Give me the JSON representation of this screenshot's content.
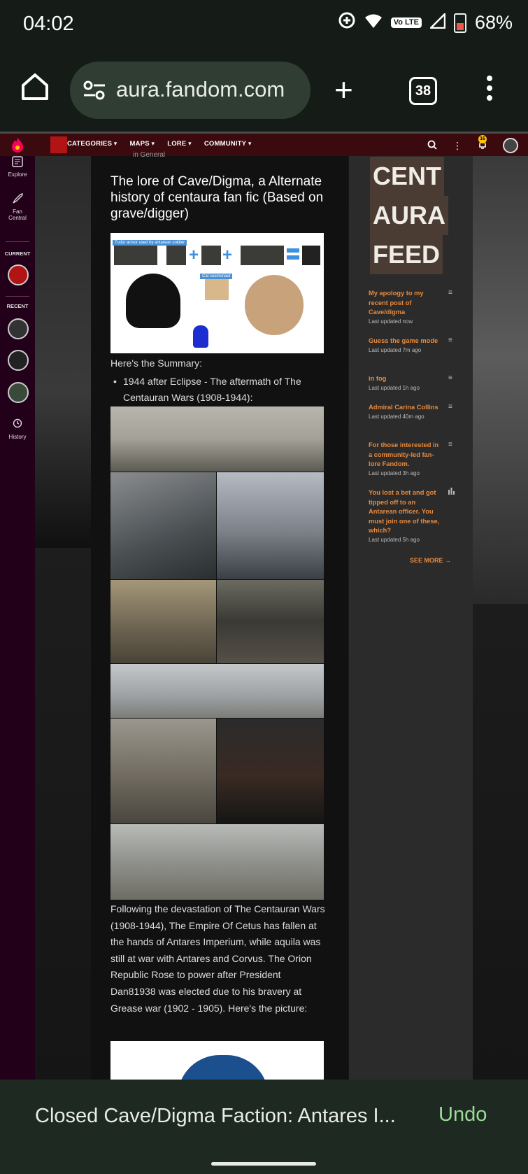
{
  "status": {
    "time": "04:02",
    "battery": "68%",
    "network_badge": "Vo LTE"
  },
  "browser": {
    "url": "aura.fandom.com",
    "tab_count": "38"
  },
  "site_nav": {
    "items": [
      "CATEGORIES",
      "MAPS",
      "LORE",
      "COMMUNITY"
    ],
    "notifications": "16"
  },
  "rail": {
    "explore": "Explore",
    "fan_central": "Fan Central",
    "current": "CURRENT",
    "recent": "RECENT",
    "history": "History"
  },
  "article": {
    "category": "in General",
    "title": "The lore of Cave/Digma, a Alternate history of centaura fan fic (Based on grave/digger)",
    "meme_label_1": "Tudor armor used by antarean soldier",
    "meme_label_2": "Cat cosmonaut",
    "summary_intro": "Here's the Summary:",
    "bullet_1": "1944 after Eclipse - The aftermath of The Centauran Wars (1908-1944):",
    "paragraph": "Following the devastation of The Centauran Wars (1908-1944), The Empire Of Cetus has fallen at the hands of Antares Imperium, while aquila was still at war with Antares and Corvus. The Orion Republic Rose to power after President Dan81938 was elected due to his bravery at Grease war (1902 - 1905). Here's the picture:"
  },
  "feed": {
    "title_lines": [
      "CENT",
      "AURA",
      "FEED"
    ],
    "items": [
      {
        "title": "My apology to my recent post of Cave/digma",
        "updated": "Last updated now",
        "icon": "text-icon"
      },
      {
        "title": "Guess the game mode",
        "updated": "Last updated 7m ago",
        "icon": "text-icon"
      },
      {
        "title": "in fog",
        "updated": "Last updated 1h ago",
        "icon": "text-icon"
      },
      {
        "title": "Admiral Carina Collins",
        "updated": "Last updated 40m ago",
        "icon": "text-icon"
      },
      {
        "title": "For those interested in a community-led fan-lore Fandom.",
        "updated": "Last updated 3h ago",
        "icon": "text-icon"
      },
      {
        "title": "You lost a bet and got tipped off to an Antarean officer. You must join one of these, which?",
        "updated": "Last updated 5h ago",
        "icon": "poll-icon"
      }
    ],
    "see_more": "SEE MORE"
  },
  "snackbar": {
    "message": "Closed Cave/Digma Faction: Antares I...",
    "action": "Undo"
  },
  "colors": {
    "accent": "#ea8a3c",
    "site_bar": "#3a0a0f",
    "rail": "#23001a",
    "snackbar": "#1e2a21",
    "undo": "#9dd99a"
  }
}
